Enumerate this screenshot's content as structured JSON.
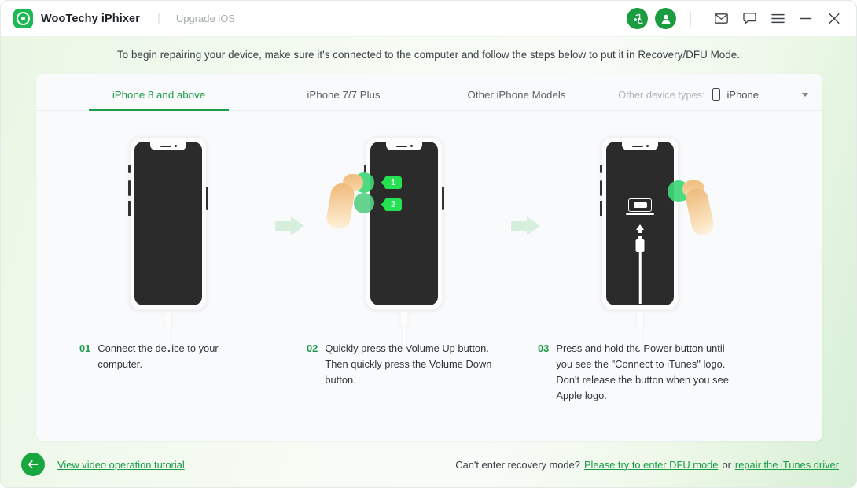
{
  "titlebar": {
    "logo_icon": "phixer-logo-icon",
    "brand": "WooTechy iPhixer",
    "separator": "|",
    "subtitle": "Upgrade iOS",
    "icons": {
      "itunes": "music-search-icon",
      "account": "user-account-icon",
      "mail": "mail-icon",
      "feedback": "chat-icon",
      "menu": "hamburger-menu-icon",
      "minimize": "minimize-icon",
      "close": "close-icon"
    }
  },
  "headline": "To begin repairing your device, make sure it's connected to the computer and follow the steps below to put it in Recovery/DFU Mode.",
  "tabs": [
    {
      "label": "iPhone 8 and above",
      "active": true
    },
    {
      "label": "iPhone 7/7 Plus",
      "active": false
    },
    {
      "label": "Other iPhone Models",
      "active": false
    }
  ],
  "device_select": {
    "label": "Other device types:",
    "icon": "phone-icon",
    "value": "iPhone",
    "caret": "chevron-down-icon"
  },
  "steps": [
    {
      "number": "01",
      "text": "Connect the device to your computer."
    },
    {
      "number": "02",
      "text": "Quickly press the Volume Up button. Then quickly press the Volume Down button.",
      "badges": [
        "1",
        "2"
      ]
    },
    {
      "number": "03",
      "text": "Press and hold the Power button until you see the \"Connect to iTunes\" logo. Don't release the button when you see Apple logo."
    }
  ],
  "footer": {
    "back_icon": "back-arrow-icon",
    "tutorial_link": "View video operation tutorial",
    "recovery_question": "Can't enter recovery mode?",
    "dfu_link": "Please try to enter DFU mode",
    "or_text": "or",
    "itunes_link": "repair the iTunes driver"
  },
  "colors": {
    "accent_green": "#1a9c46",
    "badge_green": "#25e253",
    "arrow_green": "#d6efdd",
    "card_bg": "#f8fafc",
    "screen_dark": "#2b2b2b"
  }
}
